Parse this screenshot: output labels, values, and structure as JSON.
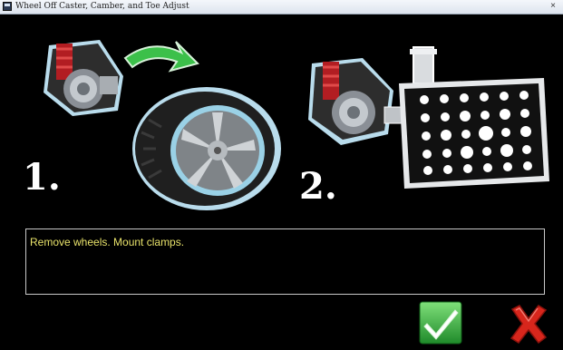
{
  "window": {
    "title": "Wheel Off Caster, Camber, and Toe Adjust",
    "close_glyph": "×"
  },
  "steps": [
    {
      "label": "1.",
      "icon": "wheel-removal-illustration"
    },
    {
      "label": "2.",
      "icon": "clamp-target-mounting-illustration"
    }
  ],
  "message": {
    "text": "Remove wheels. Mount clamps."
  },
  "actions": {
    "ok_icon": "green-checkmark-icon",
    "cancel_icon": "red-x-icon"
  },
  "colors": {
    "background": "#000000",
    "message_text": "#e8e26a",
    "outline_glow": "#9fd3e6",
    "arrow_green": "#3cc04a",
    "check_green": "#2fb03a",
    "cancel_red": "#d8261c"
  }
}
